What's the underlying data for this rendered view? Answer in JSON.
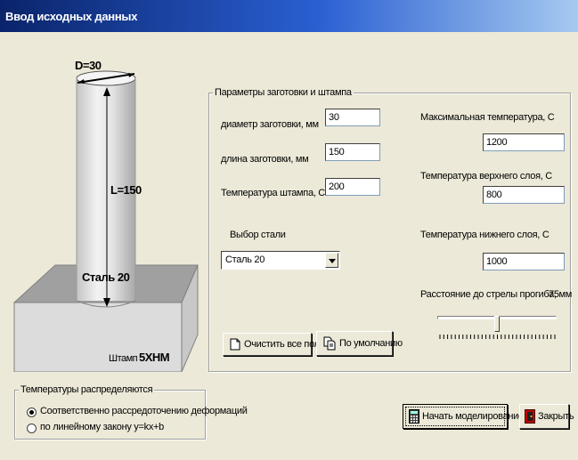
{
  "window": {
    "title": "Ввод исходных данных"
  },
  "illustration": {
    "diameter_label": "D=30",
    "length_label": "L=150",
    "steel_label": "Сталь 20",
    "stamp_label": "Штамп",
    "stamp_material": "5ХНМ"
  },
  "params": {
    "group_title": "Параметры заготовки и штампа",
    "diameter": {
      "label": "диаметр заготовки, мм",
      "value": "30"
    },
    "length": {
      "label": "длина заготовки, мм",
      "value": "150"
    },
    "stamp_temp": {
      "label": "Температура штампа, С",
      "value": "200"
    },
    "steel": {
      "label": "Выбор  стали",
      "selected": "Сталь 20"
    },
    "max_temp": {
      "label": "Максимальная температура, С",
      "value": "1200"
    },
    "top_temp": {
      "label": "Температура верхнего слоя, С",
      "value": "800"
    },
    "bottom_temp": {
      "label": "Температура нижнего слоя, С",
      "value": "1000"
    },
    "distance": {
      "label": "Расстояние до стрелы прогиба, мм",
      "value": "75",
      "min": 0,
      "max": 150
    },
    "clear_button": "Очистить все поля",
    "default_button": "По умолчанию"
  },
  "distribution": {
    "group_title": "Температуры распределяются",
    "options": [
      {
        "label": "Соответственно рассредоточению деформаций",
        "checked": true
      },
      {
        "label": "по линейному закону y=kx+b",
        "checked": false
      }
    ]
  },
  "actions": {
    "start_button": "Начать моделирование",
    "close_button": "Закрыть"
  }
}
